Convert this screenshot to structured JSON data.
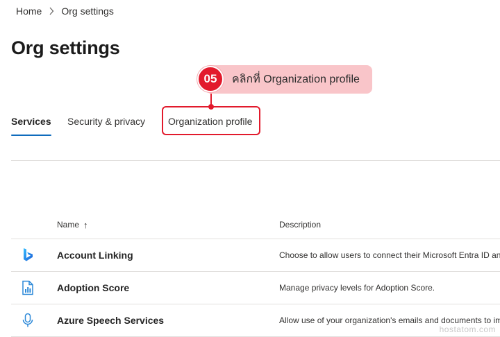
{
  "breadcrumb": {
    "home": "Home",
    "current": "Org settings"
  },
  "page": {
    "title": "Org settings"
  },
  "tabs": [
    {
      "label": "Services",
      "active": true
    },
    {
      "label": "Security & privacy",
      "active": false
    },
    {
      "label": "Organization profile",
      "active": false
    }
  ],
  "callout": {
    "step": "05",
    "text": "คลิกที่ Organization profile"
  },
  "table": {
    "columns": {
      "name": "Name",
      "sort_indicator": "↑",
      "description": "Description"
    },
    "rows": [
      {
        "icon": "bing-icon",
        "name": "Account Linking",
        "description": "Choose to allow users to connect their Microsoft Entra ID and Microsoft accounts"
      },
      {
        "icon": "report-icon",
        "name": "Adoption Score",
        "description": "Manage privacy levels for Adoption Score."
      },
      {
        "icon": "microphone-icon",
        "name": "Azure Speech Services",
        "description": "Allow use of your organization's emails and documents to improve speech recognition"
      }
    ]
  },
  "watermark": "hostatom.com",
  "colors": {
    "accent": "#0f6cbd",
    "highlight": "#e21a2c",
    "callout_bg": "#f9c5c9"
  }
}
